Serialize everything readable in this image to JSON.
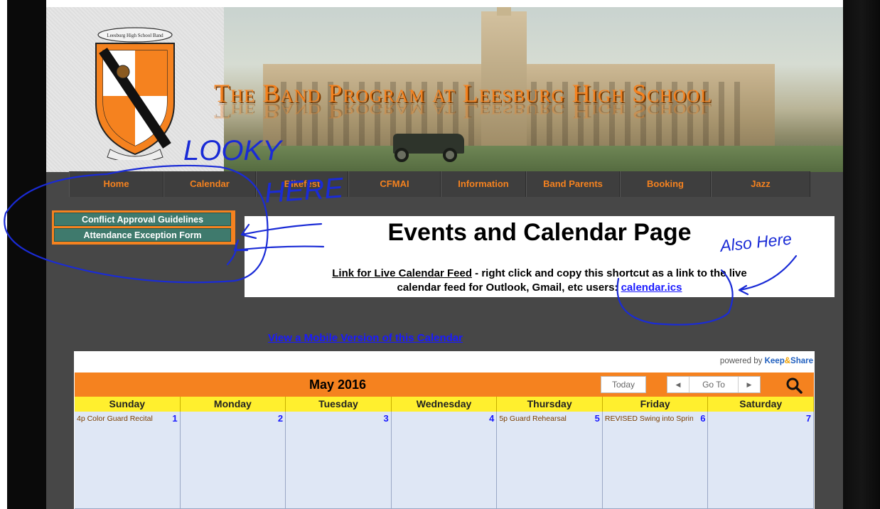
{
  "header": {
    "title": "The Band Program at Leesburg High School",
    "crest_text": "Leesburg High School Band"
  },
  "nav": {
    "items": [
      {
        "label": "Home",
        "w": 133
      },
      {
        "label": "Calendar",
        "w": 130
      },
      {
        "label": "Bikefest",
        "w": 130
      },
      {
        "label": "CFMAI",
        "w": 130
      },
      {
        "label": "Information",
        "w": 120
      },
      {
        "label": "Band Parents",
        "w": 132
      },
      {
        "label": "Booking",
        "w": 128
      },
      {
        "label": "Jazz",
        "w": 140
      }
    ]
  },
  "side_buttons": {
    "conflict": "Conflict Approval Guidelines",
    "attendance": "Attendance Exception Form"
  },
  "events": {
    "title": "Events and Calendar Page",
    "feed_label": "Link for Live Calendar Feed",
    "feed_text_1": " - right click and copy this shortcut as a link to the live",
    "feed_text_2": "calendar feed for Outlook, Gmail, etc users: ",
    "feed_link": "calendar.ics"
  },
  "mobile_link": "View a Mobile Version of this Calendar",
  "calendar": {
    "powered_by": "powered by",
    "brand_keep": "Keep",
    "brand_amp": "&",
    "brand_share": "Share",
    "month": "May 2016",
    "today": "Today",
    "goto": "Go To",
    "prev": "◀",
    "next": "▶",
    "weekdays": [
      "Sunday",
      "Monday",
      "Tuesday",
      "Wednesday",
      "Thursday",
      "Friday",
      "Saturday"
    ],
    "days": [
      {
        "num": "1",
        "event": "4p Color Guard Recital"
      },
      {
        "num": "2",
        "event": ""
      },
      {
        "num": "3",
        "event": ""
      },
      {
        "num": "4",
        "event": ""
      },
      {
        "num": "5",
        "event": "5p Guard Rehearsal"
      },
      {
        "num": "6",
        "event": "REVISED Swing into Spring"
      },
      {
        "num": "7",
        "event": ""
      }
    ]
  },
  "annotations": {
    "looky": "LOOKY",
    "here": "HERE",
    "also_here": "Also Here",
    "ink_color": "#1a2bd6"
  },
  "colors": {
    "accent": "#f5821f",
    "button_green": "#3f7a6d",
    "weekday_yellow": "#ffef2e",
    "day_cell": "#dfe7f5",
    "link_blue": "#1a1aff"
  }
}
